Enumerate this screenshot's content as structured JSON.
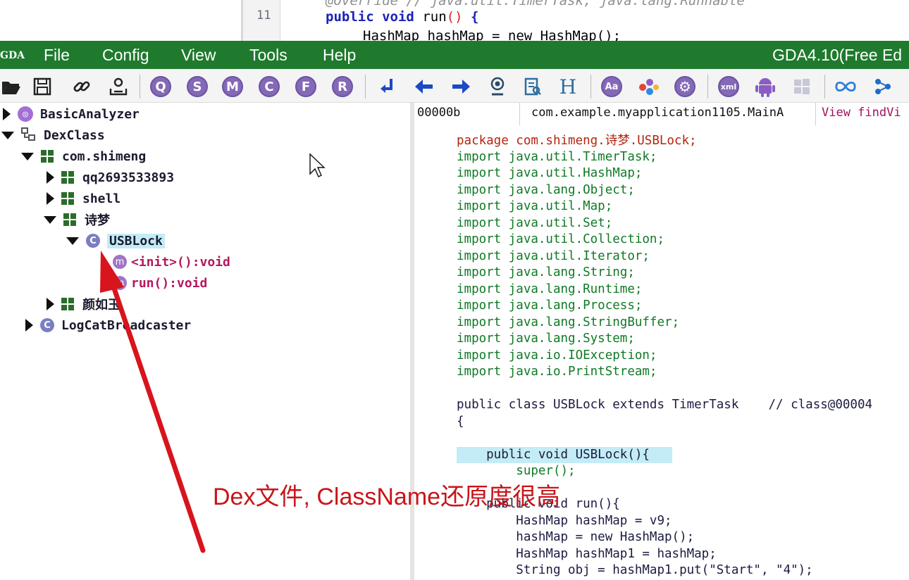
{
  "background_editor": {
    "line_number": "11",
    "comment_line": "@Override // java.util.TimerTask, java.lang.Runnable",
    "keyword_public": "public",
    "keyword_void": "void",
    "method_name": "run",
    "parens": "()",
    "brace": "{",
    "next_line": "HashMap hashMap = new HashMap();"
  },
  "menu": {
    "logo_text": "GDA",
    "items": [
      "File",
      "Config",
      "View",
      "Tools",
      "Help"
    ],
    "app_title": "GDA4.10(Free Ed"
  },
  "toolbar": {
    "letter_icons": [
      "Q",
      "S",
      "M",
      "C",
      "F",
      "R"
    ]
  },
  "tree": {
    "items": [
      {
        "label": "BasicAnalyzer",
        "icon": "analyzer-icon",
        "expanded": false
      },
      {
        "label": "DexClass",
        "icon": "dex-icon",
        "expanded": true
      },
      {
        "label": "com.shimeng",
        "icon": "package-icon",
        "expanded": true
      },
      {
        "label": "qq2693533893",
        "icon": "package-icon",
        "expanded": false
      },
      {
        "label": "shell",
        "icon": "package-icon",
        "expanded": false
      },
      {
        "label": "诗梦",
        "icon": "package-icon",
        "expanded": true
      },
      {
        "label": "USBLock",
        "icon": "class-icon",
        "expanded": true,
        "selected": true
      },
      {
        "label": "<init>():void",
        "icon": "method-icon"
      },
      {
        "label": "run():void",
        "icon": "method-icon"
      },
      {
        "label": "颜如玉",
        "icon": "package-icon",
        "expanded": false
      },
      {
        "label": "LogCatBroadcaster",
        "icon": "class-icon",
        "expanded": false
      }
    ],
    "class_icon_letter": "C",
    "method_icon_letter": "m"
  },
  "info_bar": {
    "offset": "00000b",
    "class_path": "com.example.myapplication1105.MainA",
    "action": "View findVi"
  },
  "code": {
    "package_line": "package com.shimeng.诗梦.USBLock;",
    "imports": [
      "import java.util.TimerTask;",
      "import java.util.HashMap;",
      "import java.lang.Object;",
      "import java.util.Map;",
      "import java.util.Set;",
      "import java.util.Collection;",
      "import java.util.Iterator;",
      "import java.lang.String;",
      "import java.lang.Runtime;",
      "import java.lang.Process;",
      "import java.lang.StringBuffer;",
      "import java.lang.System;",
      "import java.io.IOException;",
      "import java.io.PrintStream;"
    ],
    "class_decl": "public class USBLock extends TimerTask    // class@00004",
    "open_brace": "{",
    "ctor_line": "    public void USBLock(){",
    "super_line": "        super();",
    "run_line": "    public void run(){",
    "body": [
      "        HashMap hashMap = v9;",
      "        hashMap = new HashMap();",
      "        HashMap hashMap1 = hashMap;",
      "        String obj = hashMap1.put(\"Start\", \"4\");"
    ]
  },
  "annotation": {
    "text": "Dex文件, ClassName还原度很高",
    "color": "#c8151a"
  },
  "colors": {
    "menubar": "#1f7a2e",
    "selection": "#c3ecf6",
    "import_green": "#0f7a25",
    "package_red": "#b5240f",
    "method_magenta": "#b4185f",
    "arrow_red": "#d8141c"
  }
}
